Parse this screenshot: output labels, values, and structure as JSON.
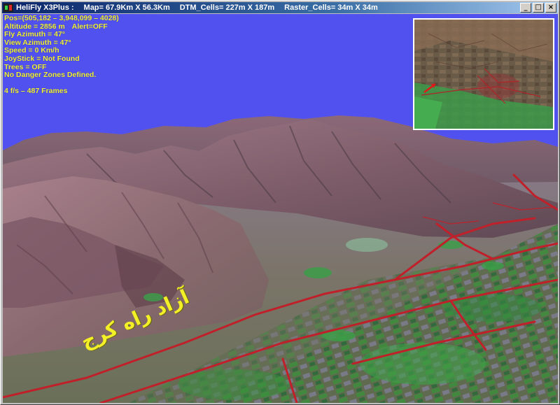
{
  "window": {
    "app_title": "HeliFly X3Plus :",
    "map_info": "Map= 67.9Km X 56.3Km",
    "dtm_info": "DTM_Cells= 227m X 187m",
    "raster_info": "Raster_Cells= 34m X 34m",
    "controls": {
      "minimize": "_",
      "maximize": "□",
      "close": "×"
    }
  },
  "hud": {
    "position": "Pos=(505,182 – 3,948,099 – 4028)",
    "altitude": "Altitude = 2856 m",
    "alert": "Alert=OFF",
    "fly_azimuth": "Fly Azimuth = 47°",
    "view_azimuth": "View Azimuth = 47°",
    "speed": "Speed = 0 Km/h",
    "joystick": "JoyStick = Not Found",
    "trees": "Trees = OFF",
    "danger_zones": "No Danger Zones Defined.",
    "fps": "4 f/s – 487 Frames"
  },
  "scene": {
    "place_label": "آزاد راه کرج",
    "sky_color": "#5151f0",
    "road_color": "#c0202a",
    "label_color": "#f4f028"
  },
  "icons": [
    "app-icon",
    "minimize-icon",
    "maximize-icon",
    "close-icon",
    "aircraft-marker-icon"
  ]
}
